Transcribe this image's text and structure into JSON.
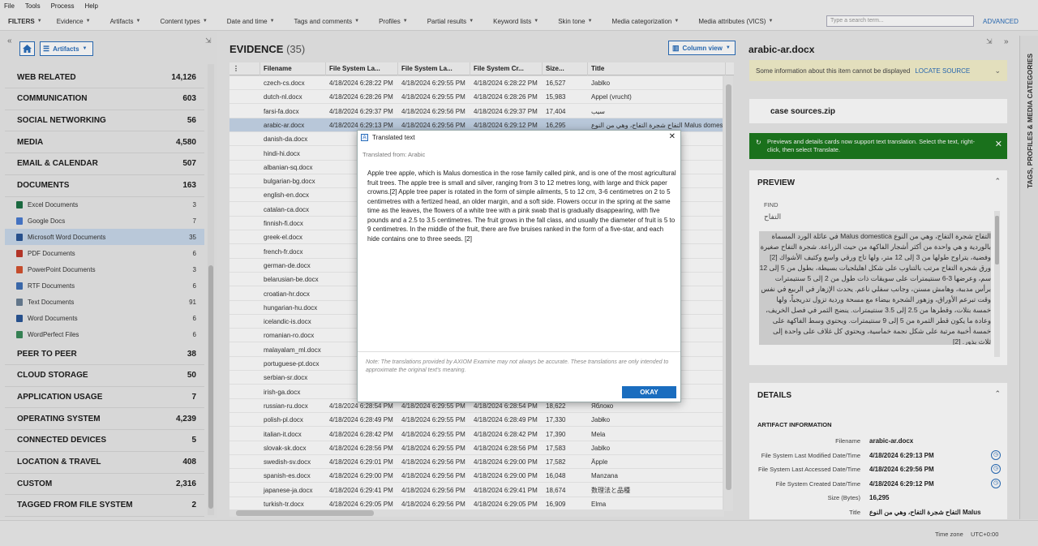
{
  "menu": [
    "File",
    "Tools",
    "Process",
    "Help"
  ],
  "filters": {
    "label": "FILTERS",
    "items": [
      "Evidence",
      "Artifacts",
      "Content types",
      "Date and time",
      "Tags and comments",
      "Profiles",
      "Partial results",
      "Keyword lists",
      "Skin tone",
      "Media categorization",
      "Media attributes (VICS)"
    ]
  },
  "search": {
    "placeholder": "Type a search term..."
  },
  "advanced_label": "ADVANCED",
  "left": {
    "artifacts_button": "Artifacts",
    "categories": [
      {
        "name": "WEB RELATED",
        "count": "14,126"
      },
      {
        "name": "COMMUNICATION",
        "count": "603"
      },
      {
        "name": "SOCIAL NETWORKING",
        "count": "56"
      },
      {
        "name": "MEDIA",
        "count": "4,580"
      },
      {
        "name": "EMAIL & CALENDAR",
        "count": "507"
      },
      {
        "name": "DOCUMENTS",
        "count": "163"
      }
    ],
    "documents": [
      {
        "name": "Excel Documents",
        "count": "3",
        "color": "#1e7145"
      },
      {
        "name": "Google Docs",
        "count": "7",
        "color": "#4a7bd0"
      },
      {
        "name": "Microsoft Word Documents",
        "count": "35",
        "color": "#2b5797"
      },
      {
        "name": "PDF Documents",
        "count": "6",
        "color": "#c0392b"
      },
      {
        "name": "PowerPoint Documents",
        "count": "3",
        "color": "#d35230"
      },
      {
        "name": "RTF Documents",
        "count": "6",
        "color": "#3f6fb5"
      },
      {
        "name": "Text Documents",
        "count": "91",
        "color": "#6a7f95"
      },
      {
        "name": "Word Documents",
        "count": "6",
        "color": "#2b5797"
      },
      {
        "name": "WordPerfect Files",
        "count": "6",
        "color": "#3a8a5a"
      }
    ],
    "categories2": [
      {
        "name": "PEER TO PEER",
        "count": "38"
      },
      {
        "name": "CLOUD STORAGE",
        "count": "50"
      },
      {
        "name": "APPLICATION USAGE",
        "count": "7"
      },
      {
        "name": "OPERATING SYSTEM",
        "count": "4,239"
      },
      {
        "name": "CONNECTED DEVICES",
        "count": "5"
      },
      {
        "name": "LOCATION & TRAVEL",
        "count": "408"
      },
      {
        "name": "CUSTOM",
        "count": "2,316"
      },
      {
        "name": "TAGGED FROM FILE SYSTEM",
        "count": "2"
      }
    ]
  },
  "evidence": {
    "title": "EVIDENCE",
    "count": "(35)",
    "column_view": "Column view",
    "columns": [
      "Filename",
      "File System La...",
      "File System La...",
      "File System Cr...",
      "Size...",
      "Title"
    ],
    "rows": [
      [
        "czech-cs.docx",
        "4/18/2024 6:28:22 PM",
        "4/18/2024 6:29:55 PM",
        "4/18/2024 6:28:22 PM",
        "16,527",
        "Jablko"
      ],
      [
        "dutch-nl.docx",
        "4/18/2024 6:28:26 PM",
        "4/18/2024 6:29:55 PM",
        "4/18/2024 6:28:26 PM",
        "15,983",
        "Appel (vrucht)"
      ],
      [
        "farsi-fa.docx",
        "4/18/2024 6:29:37 PM",
        "4/18/2024 6:29:56 PM",
        "4/18/2024 6:29:37 PM",
        "17,404",
        "سیب"
      ],
      [
        "arabic-ar.docx",
        "4/18/2024 6:29:13 PM",
        "4/18/2024 6:29:56 PM",
        "4/18/2024 6:29:12 PM",
        "16,295",
        "التفاح شجرة التفاح، وهي من النوع Malus domestica"
      ],
      [
        "danish-da.docx",
        "",
        "",
        "",
        "",
        ""
      ],
      [
        "hindi-hi.docx",
        "",
        "",
        "",
        "",
        ""
      ],
      [
        "albanian-sq.docx",
        "",
        "",
        "",
        "",
        ""
      ],
      [
        "bulgarian-bg.docx",
        "",
        "",
        "",
        "",
        ""
      ],
      [
        "english-en.docx",
        "",
        "",
        "",
        "",
        ""
      ],
      [
        "catalan-ca.docx",
        "",
        "",
        "",
        "",
        ""
      ],
      [
        "finnish-fi.docx",
        "",
        "",
        "",
        "",
        ""
      ],
      [
        "greek-el.docx",
        "",
        "",
        "",
        "",
        ""
      ],
      [
        "french-fr.docx",
        "",
        "",
        "",
        "",
        ""
      ],
      [
        "german-de.docx",
        "",
        "",
        "",
        "",
        ""
      ],
      [
        "belarusian-be.docx",
        "",
        "",
        "",
        "",
        ""
      ],
      [
        "croatian-hr.docx",
        "",
        "",
        "",
        "",
        ""
      ],
      [
        "hungarian-hu.docx",
        "",
        "",
        "",
        "",
        ""
      ],
      [
        "icelandic-is.docx",
        "",
        "",
        "",
        "",
        ""
      ],
      [
        "romanian-ro.docx",
        "",
        "",
        "",
        "",
        ""
      ],
      [
        "malayalam_ml.docx",
        "",
        "",
        "",
        "",
        ""
      ],
      [
        "portuguese-pt.docx",
        "",
        "",
        "",
        "",
        ""
      ],
      [
        "serbian-sr.docx",
        "",
        "",
        "",
        "",
        ""
      ],
      [
        "irish-ga.docx",
        "",
        "",
        "",
        "",
        ""
      ],
      [
        "russian-ru.docx",
        "4/18/2024 6:28:54 PM",
        "4/18/2024 6:29:55 PM",
        "4/18/2024 6:28:54 PM",
        "18,622",
        "Яблоко"
      ],
      [
        "polish-pl.docx",
        "4/18/2024 6:28:49 PM",
        "4/18/2024 6:29:55 PM",
        "4/18/2024 6:28:49 PM",
        "17,330",
        "Jabłko"
      ],
      [
        "italian-it.docx",
        "4/18/2024 6:28:42 PM",
        "4/18/2024 6:29:55 PM",
        "4/18/2024 6:28:42 PM",
        "17,390",
        "Mela"
      ],
      [
        "slovak-sk.docx",
        "4/18/2024 6:28:56 PM",
        "4/18/2024 6:29:55 PM",
        "4/18/2024 6:28:56 PM",
        "17,583",
        "Jablko"
      ],
      [
        "swedish-sv.docx",
        "4/18/2024 6:29:01 PM",
        "4/18/2024 6:29:56 PM",
        "4/18/2024 6:29:00 PM",
        "17,582",
        "Äpple"
      ],
      [
        "spanish-es.docx",
        "4/18/2024 6:29:00 PM",
        "4/18/2024 6:29:56 PM",
        "4/18/2024 6:29:00 PM",
        "16,048",
        "Manzana"
      ],
      [
        "japanese-ja.docx",
        "4/18/2024 6:29:41 PM",
        "4/18/2024 6:29:56 PM",
        "4/18/2024 6:29:41 PM",
        "18,674",
        "数理法と品種"
      ],
      [
        "turkish-tr.docx",
        "4/18/2024 6:29:05 PM",
        "4/18/2024 6:29:56 PM",
        "4/18/2024 6:29:05 PM",
        "16,909",
        "Elma"
      ]
    ]
  },
  "right": {
    "title": "arabic-ar.docx",
    "warning": "Some information about this item cannot be displayed",
    "locate": "LOCATE SOURCE",
    "source": "case sources.zip",
    "notice": "Previews and details cards now support text translation. Select the text, right-click, then select Translate.",
    "preview": "PREVIEW",
    "find": "FIND",
    "preview_heading": "التفاح",
    "preview_text": "التفاح شجرة التفاح، وهي من النوع Malus domestica في عائلة الورد المسماة بالوردية و هي واحدة من أكثر أشجار الفاكهة من حيث الزراعة. شجرة التفاح صغيرة وفضية، يتراوح طولها من 3 إلى 12 متر، ولها تاج ورقي واسع وكثيف الأشواك [2] ورق شجرة التفاح مرتب بالتناوب على شكل اهليلجيات بسيطة، بطول من 5 إلى 12 سم، وعرضها 3-6 سنتيمترات على سويقات ذات طول من 2 إلى 5 سنتيمترات برأس مدببة، وهامش مسنن، وجانب سفلي ناعم. يحدث الإزهار في الربيع في نفس وقت تبرعم الأوراق، وزهور الشجرة بيضاء مع مسحة وردية تزول تدريجياً، ولها خمسة بتلات، وقطرها من 2.5 إلى 3.5 سنتيمترات. ينضج الثمر في فصل الخريف، وعادة ما يكون قطر الثمرة من 5 إلى 9 سنتيمترات. ويحتوي وسط الفاكهة على خمسة أخبية مرتبة على شكل نجمة خماسية، ويحتوي كل غلاف على واحدة إلى ثلاث بذور. [2]",
    "details": "DETAILS",
    "artifact_info": "ARTIFACT INFORMATION",
    "fields": [
      {
        "label": "Filename",
        "value": "arabic-ar.docx"
      },
      {
        "label": "File System Last Modified Date/Time",
        "value": "4/18/2024 6:29:13 PM"
      },
      {
        "label": "File System Last Accessed Date/Time",
        "value": "4/18/2024 6:29:56 PM"
      },
      {
        "label": "File System Created Date/Time",
        "value": "4/18/2024 6:29:12 PM"
      },
      {
        "label": "Size (Bytes)",
        "value": "16,295"
      },
      {
        "label": "Title",
        "value": "التفاح شجرة التفاح، وهي من النوع Malus"
      }
    ],
    "side_tab": "TAGS, PROFILES & MEDIA CATEGORIES"
  },
  "status": {
    "label": "Time zone",
    "value": "UTC+0:00"
  },
  "modal": {
    "title": "Translated text",
    "subtitle": "Translated from: Arabic",
    "body": "Apple tree apple, which is Malus domestica in the rose family called pink, and is one of the most agricultural fruit trees. The apple tree is small and silver, ranging from 3 to 12 metres long, with large and thick paper crowns.[2] Apple tree paper is rotated in the form of simple ailments, 5 to 12 cm, 3-6 centimetres on 2 to 5 centimetres with a fertized head, an older margin, and a soft side. Flowers occur in the spring at the same time as the leaves, the flowers of a white tree with a pink swab that is gradually disappearing, with five pounds and a 2.5 to 3.5 centimetres. The fruit grows in the fall class, and usually the diameter of fruit is 5 to 9 centimetres. In the middle of the fruit, there are five bruises ranked in the form of a five-star, and each hide contains one to three seeds. [2]",
    "note": "Note: The translations provided by AXIOM Examine may not always be accurate. These translations are only intended to approximate the original text's meaning.",
    "ok": "OKAY"
  }
}
